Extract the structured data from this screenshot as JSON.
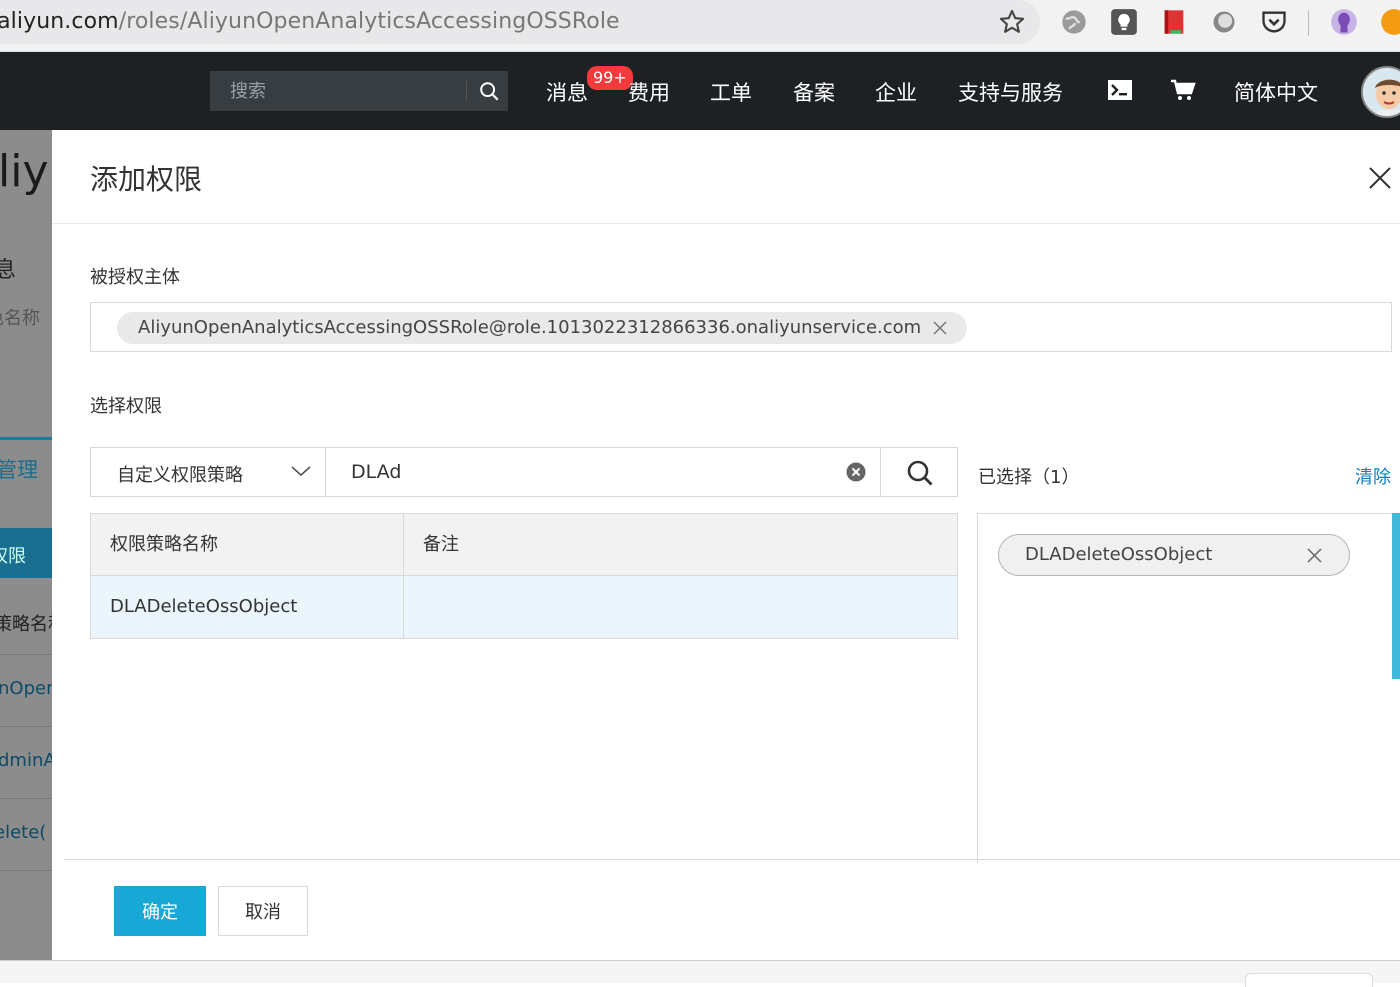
{
  "browser": {
    "url_host_prefix": ".aliyun.com",
    "url_path": "/roles/AliyunOpenAnalyticsAccessingOSSRole"
  },
  "topnav": {
    "search_placeholder": "搜索",
    "items": [
      "消息",
      "费用",
      "工单",
      "备案",
      "企业",
      "支持与服务",
      "简体中文"
    ],
    "message_badge": "99+"
  },
  "background_page": {
    "fragments": [
      "liyu",
      "息",
      "色名称",
      "管理",
      "权限",
      "策略名和",
      "nOper",
      "dminA",
      "elete("
    ]
  },
  "modal": {
    "title": "添加权限",
    "principal_label": "被授权主体",
    "principal_tag": "AliyunOpenAnalyticsAccessingOSSRole@role.1013022312866336.onaliyunservice.com",
    "permission_label": "选择权限",
    "policy_type": "自定义权限策略",
    "search_value": "DLAd",
    "table": {
      "headers": [
        "权限策略名称",
        "备注"
      ],
      "rows": [
        {
          "name": "DLADeleteOssObject",
          "note": ""
        }
      ]
    },
    "selected_label": "已选择（1）",
    "clear_label": "清除",
    "selected_items": [
      "DLADeleteOssObject"
    ],
    "ok_label": "确定",
    "cancel_label": "取消"
  },
  "colors": {
    "nav_bg": "#1e2124",
    "primary": "#18a8d6",
    "link": "#0a7fc4",
    "badge": "#f43b3b",
    "selected_row": "#eaf6fb"
  }
}
